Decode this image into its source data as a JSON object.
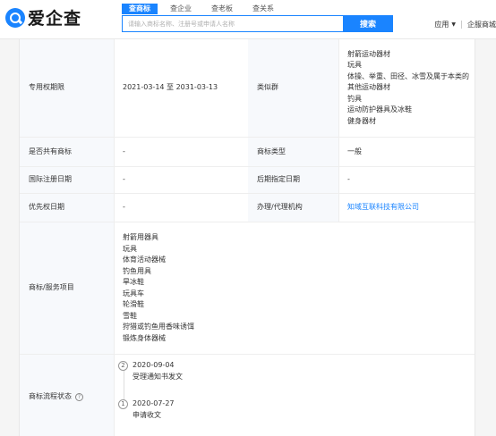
{
  "header": {
    "logo_text": "爱企查",
    "tabs": [
      {
        "label": "查商标",
        "active": true
      },
      {
        "label": "查企业",
        "active": false
      },
      {
        "label": "查老板",
        "active": false
      },
      {
        "label": "查关系",
        "active": false
      }
    ],
    "search_placeholder": "请输入商标名称、注册号或申请人名称",
    "search_button": "搜索",
    "nav": {
      "apps": "应用",
      "enterprise": "企服商城"
    }
  },
  "colors": {
    "brand": "#1a84ff",
    "label_bg": "#f7f9fc",
    "border": "#eeeeee"
  },
  "table": {
    "exclusive_period": {
      "label": "专用权期限",
      "value": "2021-03-14 至 2031-03-13"
    },
    "similar_group": {
      "label": "类似群",
      "values": [
        "射箭运动器材",
        "玩具",
        "体操、举重、田径、冰雪及属于本类的其他运动器材",
        "钓具",
        "运动防护器具及冰鞋",
        "健身器材"
      ]
    },
    "shared": {
      "label": "是否共有商标",
      "value": "-"
    },
    "type": {
      "label": "商标类型",
      "value": "一般"
    },
    "intl_date": {
      "label": "国际注册日期",
      "value": "-"
    },
    "later_date": {
      "label": "后期指定日期",
      "value": "-"
    },
    "priority": {
      "label": "优先权日期",
      "value": "-"
    },
    "agent": {
      "label": "办理/代理机构",
      "value": "知域互联科技有限公司"
    },
    "services": {
      "label": "商标/服务项目",
      "values": [
        "射箭用器具",
        "玩具",
        "体育活动器械",
        "钓鱼用具",
        "旱冰鞋",
        "玩具车",
        "轮滑鞋",
        "雪鞋",
        "狩猎或钓鱼用香味诱饵",
        "锻炼身体器械"
      ]
    },
    "flow": {
      "label": "商标流程状态",
      "steps": [
        {
          "no": "2",
          "date": "2020-09-04",
          "desc": "受理通知书发文"
        },
        {
          "no": "1",
          "date": "2020-07-27",
          "desc": "申请收文"
        }
      ]
    }
  }
}
